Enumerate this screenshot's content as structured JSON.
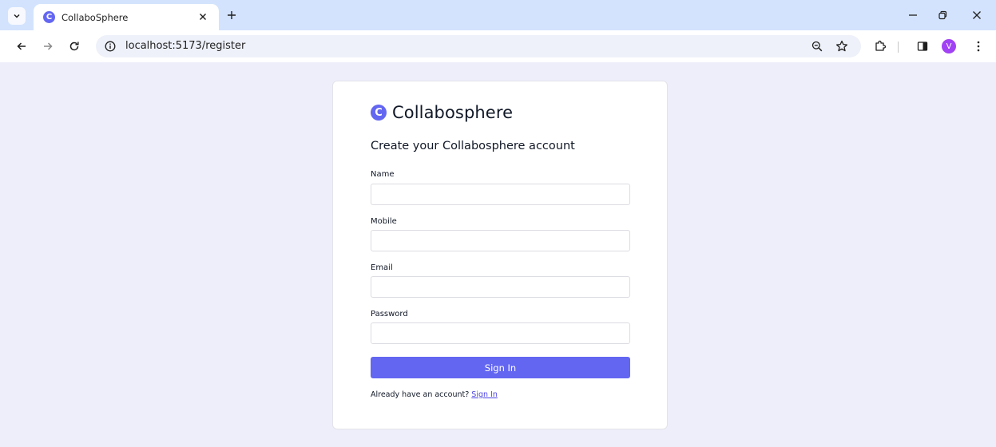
{
  "browser": {
    "tab_title": "CollaboSphere",
    "favicon_letter": "C",
    "url": "localhost:5173/register",
    "profile_initial": "V"
  },
  "page": {
    "brand_letter": "C",
    "brand_name": "Collabosphere",
    "heading": "Create your Collabosphere account",
    "fields": [
      {
        "label": "Name",
        "value": ""
      },
      {
        "label": "Mobile",
        "value": ""
      },
      {
        "label": "Email",
        "value": ""
      },
      {
        "label": "Password",
        "value": ""
      }
    ],
    "submit_label": "Sign In",
    "footer_text": "Already have an account?",
    "footer_link": "Sign In"
  },
  "colors": {
    "accent": "#6366f1",
    "page_background": "#eeeefb",
    "tabstrip": "#d3e3fd"
  },
  "icons": [
    "tab-search-icon",
    "close-icon",
    "plus-icon",
    "minimize-icon",
    "restore-icon",
    "back-icon",
    "forward-icon",
    "reload-icon",
    "info-icon",
    "zoom-icon",
    "star-icon",
    "extensions-icon",
    "side-panel-icon",
    "more-icon"
  ]
}
